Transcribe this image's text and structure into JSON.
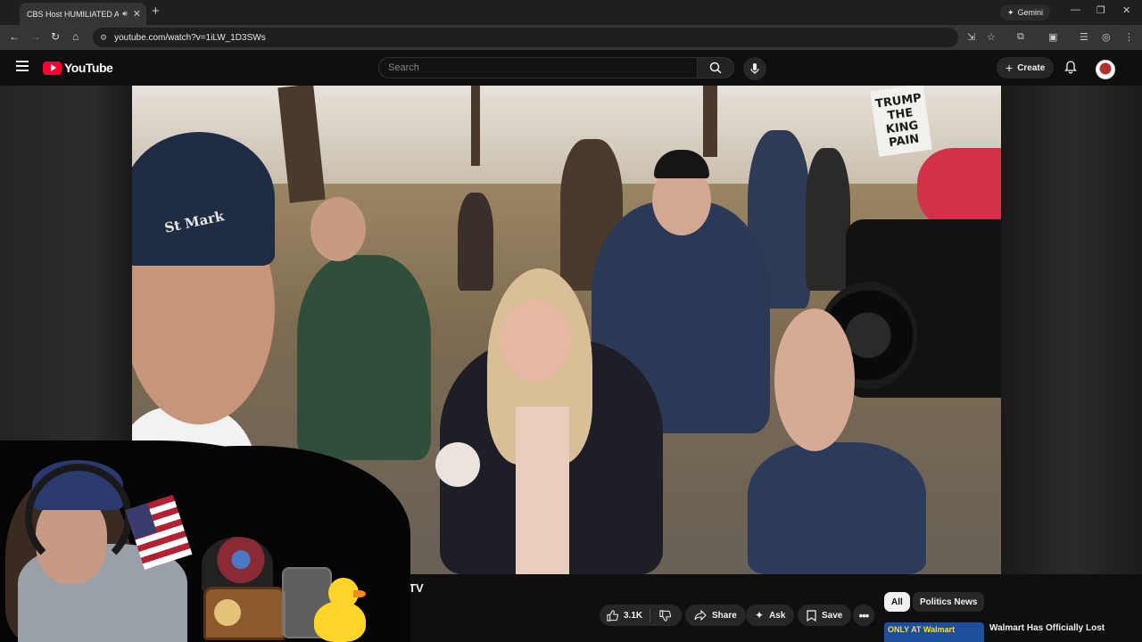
{
  "browser": {
    "tab_title": "CBS Host HUMILIATED Afte",
    "tab_audio_icon": "speaker-icon",
    "gemini_label": "Gemini",
    "url": "youtube.com/watch?v=1iLW_1D3SWs"
  },
  "youtube": {
    "logo_text": "YouTube",
    "search_placeholder": "Search",
    "create_label": "Create"
  },
  "video": {
    "sign_text": "TRUMP THE KING PAIN",
    "hat_text": "St Mark"
  },
  "below_video": {
    "title_partial": "ve TV",
    "like_count": "3.1K",
    "share_label": "Share",
    "ask_label": "Ask",
    "save_label": "Save"
  },
  "sidebar": {
    "chips": [
      {
        "label": "All",
        "selected": true
      },
      {
        "label": "Politics News",
        "selected": false
      }
    ],
    "rec_thumb_text": "ONLY AT Walmart",
    "rec_title": "Walmart Has Officially Lost"
  },
  "colors": {
    "youtube_red": "#ff0033",
    "page_bg": "#0f0f0f",
    "chip_selected_bg": "#f1f1f1"
  }
}
